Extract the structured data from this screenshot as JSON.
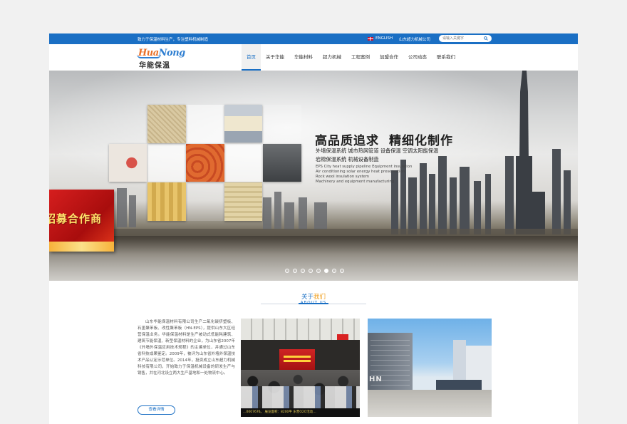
{
  "topbar": {
    "slogan": "致力于保温材料生产，专注塑料机械制造",
    "lang": "ENGLISH",
    "company": "山东超力机械公司",
    "search_placeholder": "请输入关键字"
  },
  "logo": {
    "en_prefix": "Hua",
    "en_suffix": "Nong",
    "cn": "华能保温"
  },
  "nav": [
    {
      "label": "首页",
      "active": true
    },
    {
      "label": "关于华能",
      "active": false
    },
    {
      "label": "华能材料",
      "active": false
    },
    {
      "label": "超力机械",
      "active": false
    },
    {
      "label": "工程案例",
      "active": false
    },
    {
      "label": "加盟合作",
      "active": false
    },
    {
      "label": "公司动态",
      "active": false
    },
    {
      "label": "联系我们",
      "active": false
    }
  ],
  "banner": {
    "headline_1": "高品质追求",
    "headline_2": "精细化制作",
    "line_1": "外墙保温系统   城市热网管道   设备保温   空调太阳能保温",
    "line_2": "岩棉保温系统   机械设备制造",
    "en_lines": [
      "EPS    City heat supply pipeline    Equipment insulation",
      "Air conditioning solar energy heat preservation",
      "Rock wool insulation system",
      "Machinery and equipment manufacturing"
    ],
    "promo": "招募合作商",
    "slide_count": 8,
    "active_slide": 5
  },
  "about": {
    "title_a": "关于",
    "title_b": "我们",
    "subtitle": "ABOUT US",
    "text": "山东华能保温材料有限公司生产二氧化碳挤塑板、石墨聚苯板、改性聚苯板（HN-EPS），提供山东大区经营保温业务。华能保温材料是生产被动式低能耗建筑、建筑节能保温、新型保温材料的企业，为山东省2007年《外墙外保温应用技术规程》的主编单位，并通过山东省科技成果鉴定。2009年，被评为山东省外墙外保温技术产品认定示范单位。2014年，投资成立山东超力机械科技有限公司，开始致力于保温机械设备的研发生产与销售，并在河北设立两大生产基地和一处物流中心。",
    "more_label": "查看详情",
    "photo_caption": "…0007676。  展览面积：8200平  东营O2O活动…"
  },
  "colors": {
    "brand_blue": "#1a6fc4",
    "logo_orange": "#e8712a",
    "promo_red": "#d61e1e"
  }
}
